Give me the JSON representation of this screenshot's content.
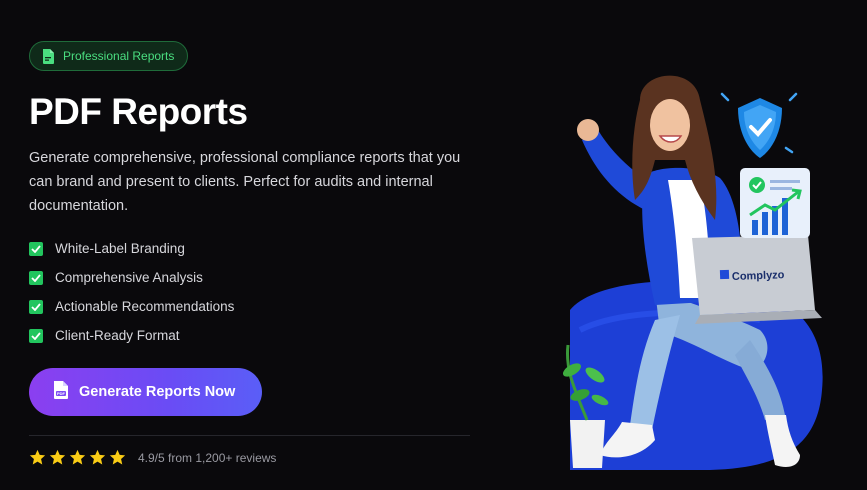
{
  "badge": {
    "label": "Professional Reports",
    "icon": "pdf-file-icon",
    "color": "#4ade80"
  },
  "title": "PDF Reports",
  "description": "Generate comprehensive, professional compliance reports that you can brand and present to clients. Perfect for audits and internal documentation.",
  "features": [
    {
      "label": "White-Label Branding"
    },
    {
      "label": "Comprehensive Analysis"
    },
    {
      "label": "Actionable Recommendations"
    },
    {
      "label": "Client-Ready Format"
    }
  ],
  "cta": {
    "label": "Generate Reports Now",
    "icon": "pdf-icon"
  },
  "rating": {
    "stars": 5,
    "text": "4.9/5 from 1,200+ reviews",
    "star_color": "#facc15"
  },
  "hero": {
    "laptop_brand": "Complyzo"
  },
  "colors": {
    "background": "#0a090c",
    "accent_green": "#22c55e",
    "cta_start": "#8b3ff0",
    "cta_end": "#5a5ef7",
    "beanbag": "#1d3fd6"
  }
}
